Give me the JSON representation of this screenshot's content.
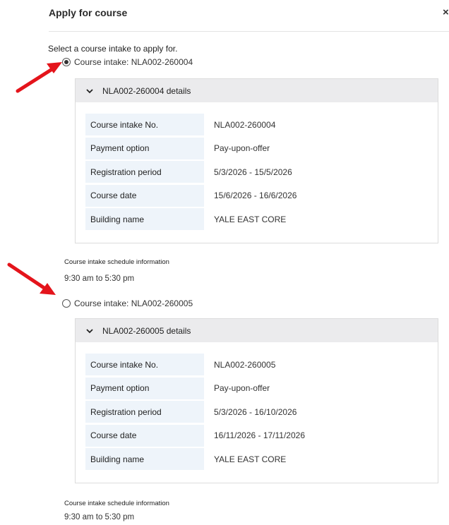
{
  "dialog": {
    "title": "Apply for course",
    "close_label": "×",
    "instruction": "Select a course intake to apply for."
  },
  "intakes": [
    {
      "radio_label": "Course intake: NLA002-260004",
      "selected": true,
      "details_header": "NLA002-260004 details",
      "rows": [
        {
          "label": "Course intake No.",
          "value": "NLA002-260004"
        },
        {
          "label": "Payment option",
          "value": "Pay-upon-offer"
        },
        {
          "label": "Registration period",
          "value": "5/3/2026 - 15/5/2026"
        },
        {
          "label": "Course date",
          "value": "15/6/2026 - 16/6/2026"
        },
        {
          "label": "Building name",
          "value": "YALE EAST CORE"
        }
      ],
      "schedule_label": "Course intake schedule information",
      "schedule_value": "9:30 am to 5:30 pm"
    },
    {
      "radio_label": "Course intake: NLA002-260005",
      "selected": false,
      "details_header": "NLA002-260005 details",
      "rows": [
        {
          "label": "Course intake No.",
          "value": "NLA002-260005"
        },
        {
          "label": "Payment option",
          "value": "Pay-upon-offer"
        },
        {
          "label": "Registration period",
          "value": "5/3/2026 - 16/10/2026"
        },
        {
          "label": "Course date",
          "value": "16/11/2026 - 17/11/2026"
        },
        {
          "label": "Building name",
          "value": "YALE EAST CORE"
        }
      ],
      "schedule_label": "Course intake schedule information",
      "schedule_value": "9:30 am to 5:30 pm"
    }
  ],
  "annotations": {
    "arrow_color": "#e4141b"
  }
}
